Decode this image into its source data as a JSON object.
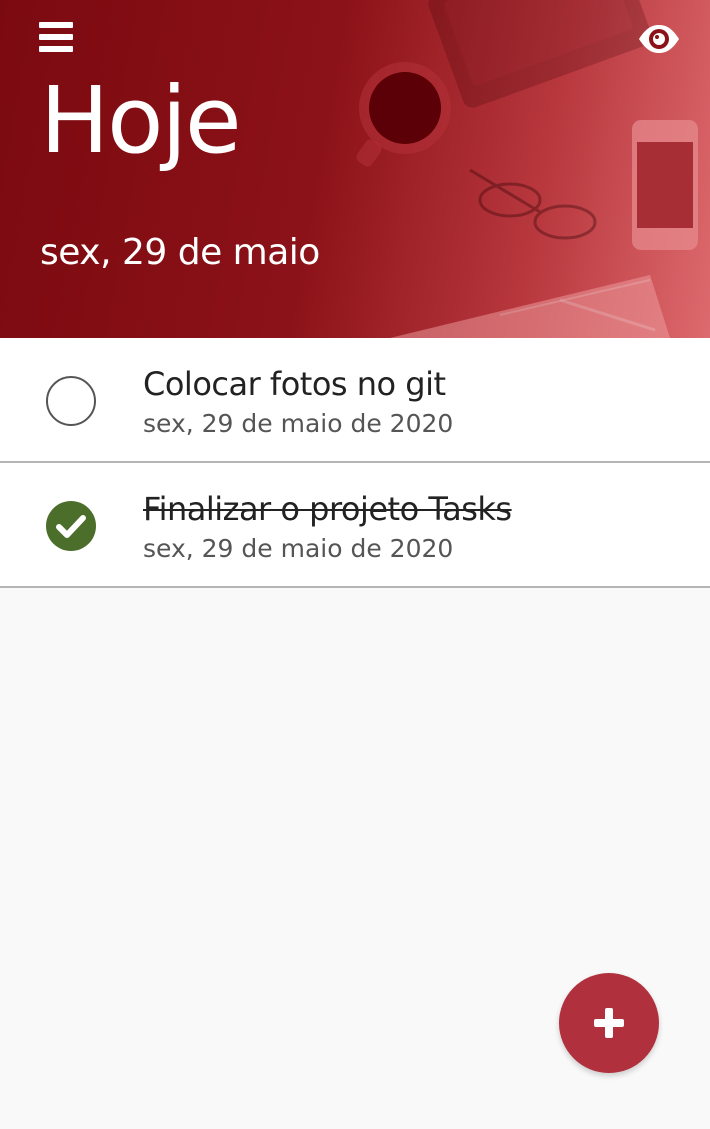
{
  "header": {
    "title": "Hoje",
    "date": "sex, 29 de maio",
    "menu_icon": "bars-icon",
    "visibility_icon": "eye-icon"
  },
  "tasks": [
    {
      "title": "Colocar fotos no git",
      "date": "sex, 29 de maio de 2020",
      "done": false
    },
    {
      "title": "Finalizar o projeto Tasks",
      "date": "sex, 29 de maio de 2020",
      "done": true
    }
  ],
  "add_button": {
    "icon": "plus-icon"
  },
  "colors": {
    "header_primary": "#8b1218",
    "done_check": "#4c6e2b",
    "fab": "#b0313d",
    "background": "#f9f9f9"
  }
}
